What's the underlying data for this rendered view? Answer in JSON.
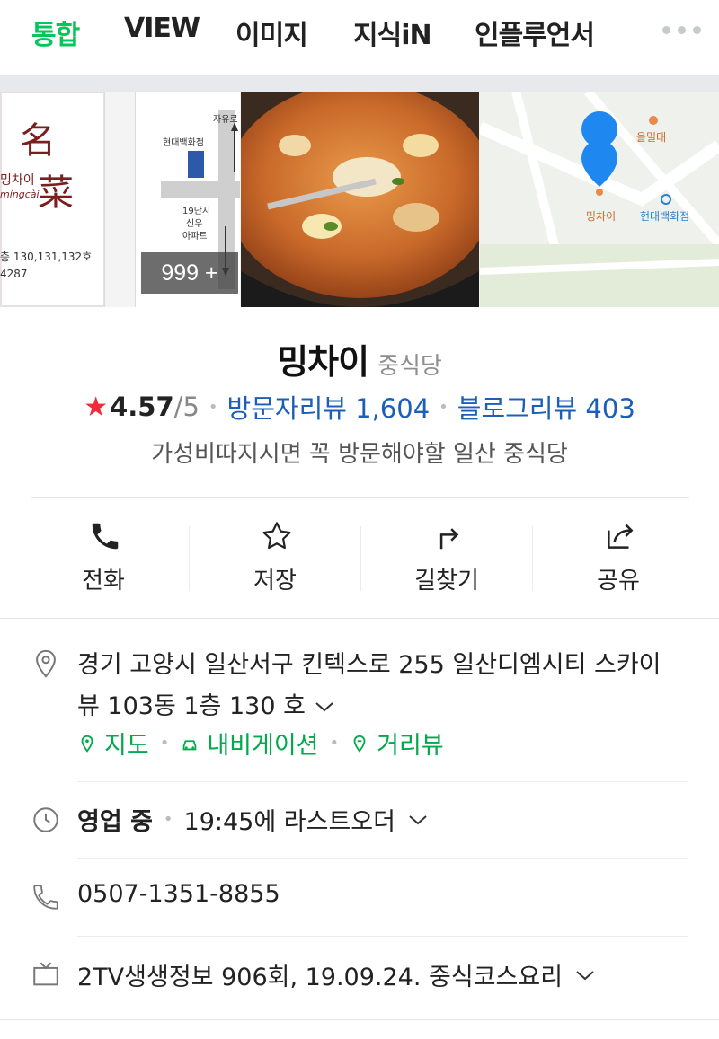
{
  "tabs": [
    {
      "label": "통합",
      "active": true
    },
    {
      "label": "VIEW",
      "active": false
    },
    {
      "label": "이미지",
      "active": false
    },
    {
      "label": "지식iN",
      "active": false
    },
    {
      "label": "인플루언서",
      "active": false
    }
  ],
  "photos": {
    "logo_text_1": "名",
    "logo_text_2": "菜",
    "logo_text_3": "밍차이",
    "logo_text_4": "míngcài",
    "logo_address": "층 130,131,132호",
    "logo_phone": "4287",
    "map_sketch_labels": {
      "road": "자유로",
      "store": "현대백화점",
      "apartment_1": "19단지",
      "apartment_2": "신우",
      "apartment_3": "아파트"
    },
    "count_badge": "999 +",
    "map_labels": {
      "poi_1": "을밀대",
      "poi_2": "밍차이",
      "poi_3": "현대백화점"
    }
  },
  "place": {
    "name": "밍차이",
    "category": "중식당",
    "star": "★",
    "rating": "4.57",
    "rating_max": "/5",
    "visitor_reviews": "방문자리뷰 1,604",
    "blog_reviews": "블로그리뷰 403",
    "description": "가성비따지시면 꼭 방문해야할 일산 중식당"
  },
  "actions": [
    {
      "label": "전화",
      "icon": "phone-icon"
    },
    {
      "label": "저장",
      "icon": "star-icon"
    },
    {
      "label": "길찾기",
      "icon": "directions-icon"
    },
    {
      "label": "공유",
      "icon": "share-icon"
    }
  ],
  "info": {
    "address_line_1": "경기 고양시 일산서구 킨텍스로 255 일산디엠시티 스카이",
    "address_line_2": "뷰 103동 1층 130 호",
    "map_link": "지도",
    "navigation_link": "내비게이션",
    "street_view_link": "거리뷰",
    "status": "영업 중",
    "last_order": "19:45에 라스트오더",
    "phone": "0507-1351-8855",
    "tv": "2TV생생정보 906회, 19.09.24. 중식코스요리"
  },
  "colors": {
    "active_tab": "#03c75a",
    "link_green": "#03a94d",
    "link_blue": "#1d5fb8",
    "star": "#f2293a"
  }
}
